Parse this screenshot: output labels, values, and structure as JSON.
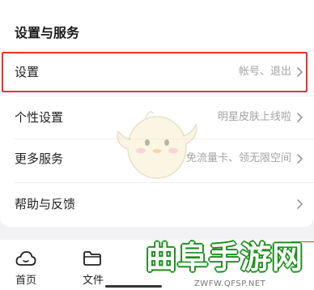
{
  "section": {
    "title": "设置与服务"
  },
  "rows": [
    {
      "label": "设置",
      "subtitle": "帐号、退出",
      "highlighted": true
    },
    {
      "label": "个性设置",
      "subtitle": "明星皮肤上线啦"
    },
    {
      "label": "更多服务",
      "subtitle": "免流量卡、领无限空间"
    },
    {
      "label": "帮助与反馈",
      "subtitle": ""
    }
  ],
  "tabbar": {
    "home_label": "首页",
    "files_label": "文件"
  },
  "watermark": {
    "brand": "曲阜手游网",
    "url": "ZWFW.QFSP.NET"
  },
  "colors": {
    "highlight_border": "#e8322d",
    "muted_text": "#a3a3a3",
    "watermark_green": "#1e8f1e"
  },
  "icons": {
    "chevron": "chevron-right-icon",
    "home": "cloud-home-icon",
    "files": "folder-icon",
    "mascot": "duck-mascot-icon"
  }
}
